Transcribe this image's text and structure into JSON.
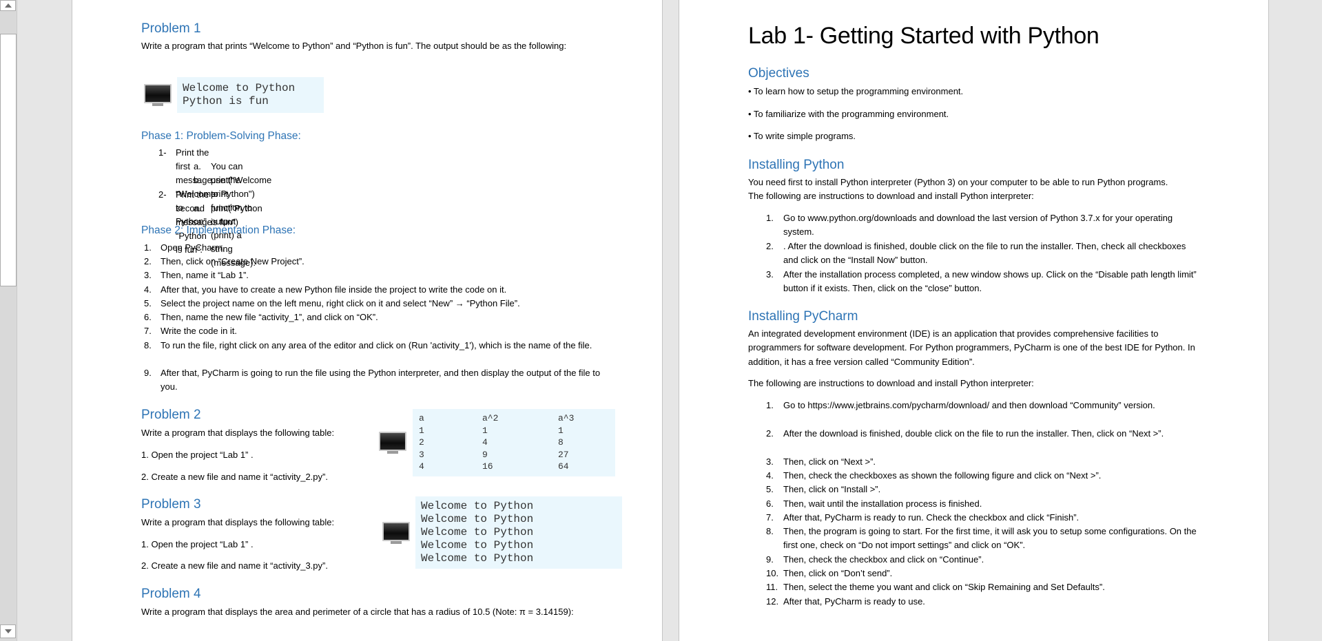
{
  "left_page": {
    "problem1": {
      "heading": "Problem 1",
      "text": "Write a program that prints “Welcome to Python” and “Python is fun”. The output should be as the following:",
      "output": [
        "Welcome to Python",
        "Python is fun"
      ],
      "phase1": {
        "heading": "Phase 1: Problem-Solving Phase:",
        "steps": [
          {
            "num": "1-",
            "text": "Print the first message “Welcome to Python”.",
            "sub": [
              {
                "num": "a.",
                "text": "You can use the print function to output (print) a string (message)."
              },
              {
                "num": "b.",
                "text": "print(\"Welcome to Python\")"
              }
            ]
          },
          {
            "num": "2-",
            "text": "Print the second message “Python is fun”.",
            "sub": [
              {
                "num": "a.",
                "text": "print(\"Python is fun\")"
              }
            ]
          }
        ]
      },
      "phase2": {
        "heading": "Phase 2: Implementation Phase:",
        "steps": [
          {
            "num": "1.",
            "text": "Open PyCharm."
          },
          {
            "num": "2.",
            "text": "Then, click on “Create New Project”."
          },
          {
            "num": "3.",
            "text": "Then, name it “Lab 1”."
          },
          {
            "num": "4.",
            "text": "After that, you have to create a new Python file inside the project to write the code on it."
          },
          {
            "num": "5.",
            "text": "Select the project name on the left menu, right click on it and select “New” → “Python File”."
          },
          {
            "num": "6.",
            "text": "Then, name the new file “activity_1”, and click on “OK”."
          },
          {
            "num": "7.",
            "text": "Write the code in it."
          },
          {
            "num": "8.",
            "text": "To run the file, right click on any area of the editor and click on (Run 'activity_1'), which is the name of the file."
          },
          {
            "num": "9.",
            "text": "After that, PyCharm is going to run the file using the Python interpreter, and then display the output of the file to you."
          }
        ]
      }
    },
    "problem2": {
      "heading": "Problem 2",
      "text": "Write a program that displays the following table:",
      "step1": "1. Open the project “Lab 1” .",
      "step2": "2. Create a new file and name it “activity_2.py”.",
      "table": {
        "headers": [
          "a",
          "a^2",
          "a^3"
        ],
        "rows": [
          [
            "1",
            "1",
            "1"
          ],
          [
            "2",
            "4",
            "8"
          ],
          [
            "3",
            "9",
            "27"
          ],
          [
            "4",
            "16",
            "64"
          ]
        ]
      }
    },
    "problem3": {
      "heading": "Problem 3",
      "text": "Write a program that displays the following table:",
      "step1": "1. Open the project “Lab 1” .",
      "step2": "2. Create a new file and name it “activity_3.py”.",
      "output": [
        "Welcome to Python",
        "Welcome to Python",
        "Welcome to Python",
        "Welcome to Python",
        "Welcome to Python"
      ]
    },
    "problem4": {
      "heading": "Problem 4",
      "text": "Write a program that displays the area and perimeter of a circle that has a radius of 10.5 (Note: π = 3.14159):"
    }
  },
  "right_page": {
    "title": "Lab 1- Getting Started with Python",
    "objectives": {
      "heading": "Objectives",
      "items": [
        "• To learn how to setup the programming environment.",
        "• To familiarize with the programming environment.",
        "• To write simple programs."
      ]
    },
    "installing_python": {
      "heading": "Installing Python",
      "intro": "You need first to install Python interpreter (Python 3) on your computer to be able to run Python programs. The following are instructions to download and install Python interpreter:",
      "steps": [
        {
          "num": "1.",
          "text": "Go to www.python.org/downloads and download the last version of Python 3.7.x for your operating system."
        },
        {
          "num": "2.",
          "text": ". After the download is finished, double click on the file to run the installer. Then, check all checkboxes and click on the “Install Now” button."
        },
        {
          "num": "3.",
          "text": "After the installation process completed, a new window shows up. Click on the “Disable path length limit” button if it exists. Then, click on the “close” button."
        }
      ]
    },
    "installing_pycharm": {
      "heading": "Installing PyCharm",
      "intro": "An integrated development environment (IDE) is an application that provides comprehensive facilities to programmers for software development. For Python programmers, PyCharm is one of the best IDE for Python. In addition, it has a free version called “Community Edition”.",
      "intro2": "The following are instructions to download and install Python interpreter:",
      "steps": [
        {
          "num": "1.",
          "text": "Go to https://www.jetbrains.com/pycharm/download/ and then download “Community” version."
        },
        {
          "num": "2.",
          "text": "After the download is finished, double click on the file to run the installer. Then, click on “Next >”."
        },
        {
          "num": "3.",
          "text": "Then, click on “Next >”."
        },
        {
          "num": "4.",
          "text": "Then, check the checkboxes as shown the following figure and click on “Next >”."
        },
        {
          "num": "5.",
          "text": "Then, click on “Install >”."
        },
        {
          "num": "6.",
          "text": "Then, wait until the installation process is finished."
        },
        {
          "num": "7.",
          "text": "After that, PyCharm is ready to run. Check the checkbox and click “Finish”."
        },
        {
          "num": "8.",
          "text": "Then, the program is going to start. For the first time, it will ask you to setup some configurations. On the first one, check on “Do not import settings” and click on “OK”."
        },
        {
          "num": "9.",
          "text": "Then, check the checkbox and click on “Continue”."
        },
        {
          "num": "10.",
          "text": "Then, click on “Don’t send”."
        },
        {
          "num": "11.",
          "text": "Then, select the theme you want and click on “Skip Remaining and Set Defaults”."
        },
        {
          "num": "12.",
          "text": "After that, PyCharm is ready to use."
        }
      ]
    }
  }
}
